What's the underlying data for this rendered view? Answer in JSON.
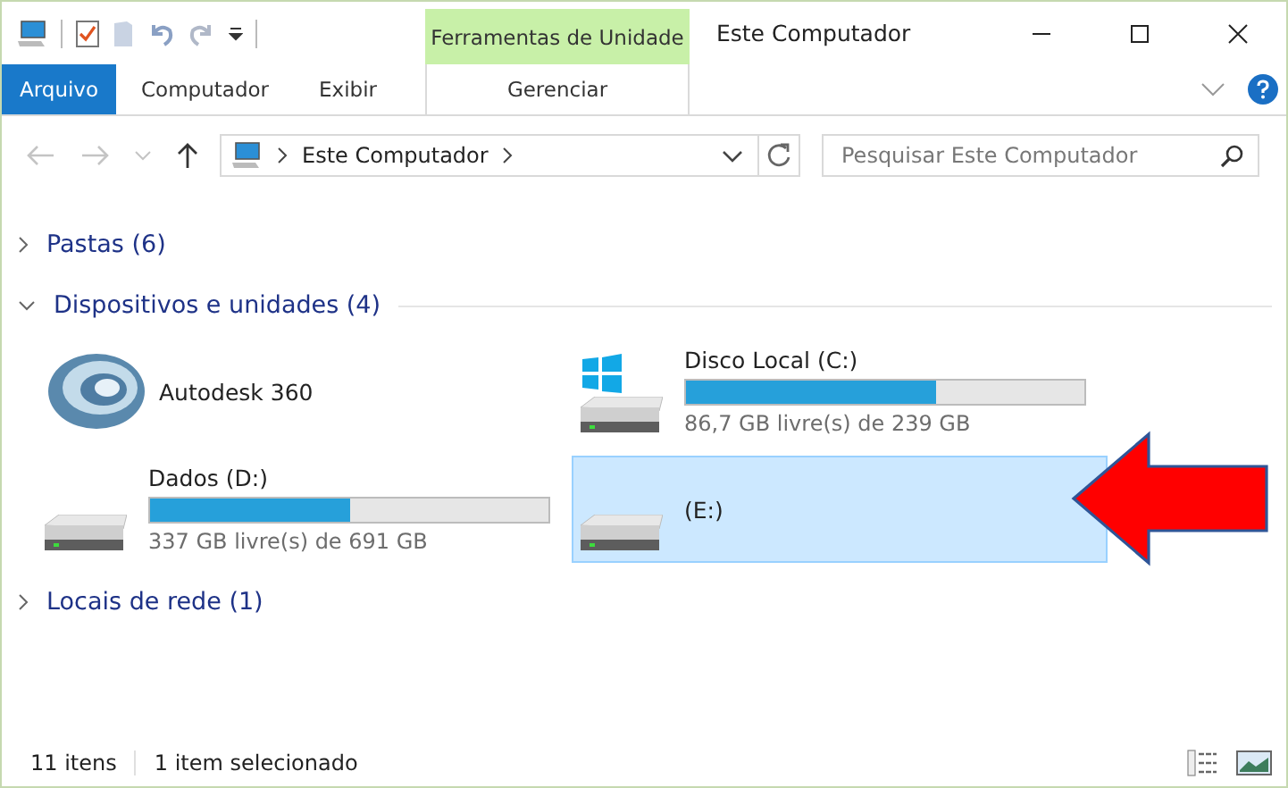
{
  "window": {
    "title": "Este Computador"
  },
  "ribbon_tabs": [
    {
      "label": "Arquivo",
      "kind": "file"
    },
    {
      "label": "Computador",
      "kind": "tab"
    },
    {
      "label": "Exibir",
      "kind": "tab"
    }
  ],
  "contextual_group": {
    "title": "Ferramentas de Unidade",
    "tabs": [
      "Gerenciar"
    ]
  },
  "address": {
    "path": [
      "Este Computador"
    ]
  },
  "search": {
    "placeholder": "Pesquisar Este Computador"
  },
  "groups": [
    {
      "label": "Pastas (6)",
      "expanded": false
    },
    {
      "label": "Dispositivos e unidades (4)",
      "expanded": true,
      "items": [
        {
          "name": "Autodesk 360",
          "kind": "app",
          "selected": false
        },
        {
          "name": "Disco Local (C:)",
          "kind": "system-drive",
          "level": 0.63,
          "free": "86,7 GB livre(s) de 239 GB",
          "selected": false
        },
        {
          "name": "Dados (D:)",
          "kind": "drive",
          "level": 0.5,
          "free": "337 GB livre(s) de 691 GB",
          "selected": false
        },
        {
          "name": "(E:)",
          "kind": "drive",
          "selected": true
        }
      ]
    },
    {
      "label": "Locais de rede (1)",
      "expanded": false
    }
  ],
  "status_bar": {
    "count": "11 itens",
    "selection": "1 item selecionado"
  }
}
